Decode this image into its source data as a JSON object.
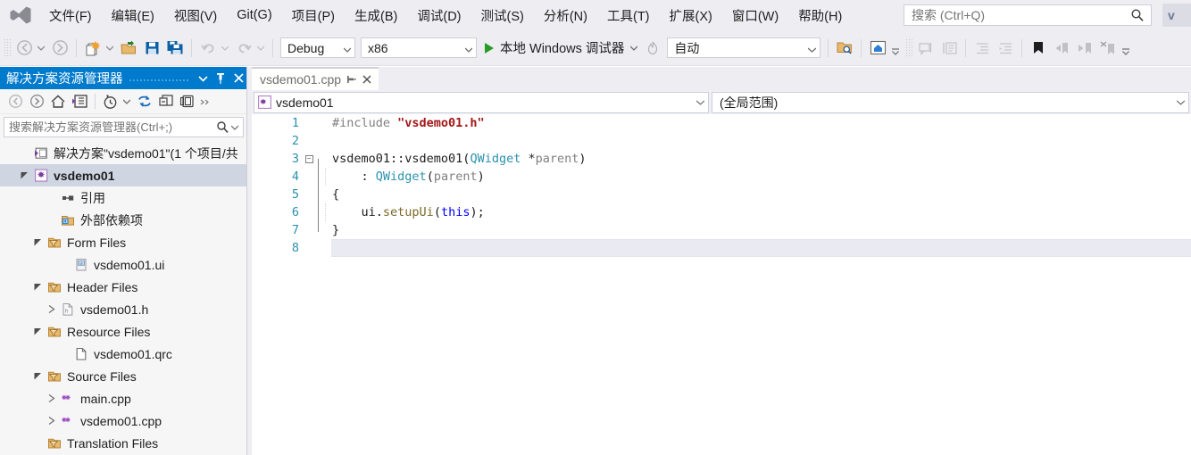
{
  "window": {
    "app": "Visual Studio",
    "title_fragment": "v",
    "logo_icon": "visual-studio-logo-icon"
  },
  "menubar": {
    "items": [
      {
        "label": "文件(F)",
        "name": "menu-file"
      },
      {
        "label": "编辑(E)",
        "name": "menu-edit"
      },
      {
        "label": "视图(V)",
        "name": "menu-view"
      },
      {
        "label": "Git(G)",
        "name": "menu-git"
      },
      {
        "label": "项目(P)",
        "name": "menu-project"
      },
      {
        "label": "生成(B)",
        "name": "menu-build"
      },
      {
        "label": "调试(D)",
        "name": "menu-debug"
      },
      {
        "label": "测试(S)",
        "name": "menu-test"
      },
      {
        "label": "分析(N)",
        "name": "menu-analyze"
      },
      {
        "label": "工具(T)",
        "name": "menu-tools"
      },
      {
        "label": "扩展(X)",
        "name": "menu-extensions"
      },
      {
        "label": "窗口(W)",
        "name": "menu-window"
      },
      {
        "label": "帮助(H)",
        "name": "menu-help"
      }
    ],
    "search": {
      "placeholder": "搜索 (Ctrl+Q)",
      "value": "",
      "icon": "search-icon"
    }
  },
  "toolbar": {
    "nav_back_icon": "navigate-back-icon",
    "nav_forward_icon": "navigate-forward-icon",
    "new_item_icon": "new-item-icon",
    "open_file_icon": "open-file-icon",
    "save_icon": "save-icon",
    "save_all_icon": "save-all-icon",
    "undo_icon": "undo-icon",
    "redo_icon": "redo-icon",
    "config": {
      "value": "Debug",
      "label": "Debug"
    },
    "platform": {
      "value": "x86",
      "label": "x86"
    },
    "run": {
      "label": "本地 Windows 调试器",
      "icon": "play-icon"
    },
    "hot_reload_icon": "hot-reload-icon",
    "auto_attach": {
      "value": "自动",
      "label": "自动"
    },
    "find_in_files_icon": "find-in-files-icon",
    "home_window_icon": "home-window-icon",
    "comment_icon": "comment-selection-icon",
    "uncomment_icon": "uncomment-selection-icon",
    "decrease_indent_icon": "decrease-indent-icon",
    "increase_indent_icon": "increase-indent-icon",
    "bookmark_icon": "bookmark-icon",
    "prev_bookmark_icon": "previous-bookmark-icon",
    "next_bookmark_icon": "next-bookmark-icon",
    "clear_bookmarks_icon": "clear-bookmarks-icon",
    "overflow_icon": "toolbar-overflow-icon"
  },
  "solution_explorer": {
    "header": {
      "title": "解决方案资源管理器",
      "dropdown_icon": "chevron-down-icon",
      "pin_icon": "pin-icon",
      "close_icon": "close-icon"
    },
    "toolbar": {
      "back_icon": "back-icon",
      "forward_icon": "forward-icon",
      "home_icon": "home-icon",
      "pending_changes_icon": "solution-view-icon",
      "show_all_files_icon": "history-clock-icon",
      "refresh_icon": "refresh-icon",
      "collapse_all_icon": "collapse-all-icon",
      "properties_icon": "properties-icon",
      "overflow_icon": "overflow-icon"
    },
    "search": {
      "placeholder": "搜索解决方案资源管理器(Ctrl+;)",
      "value": "",
      "icon": "search-icon",
      "dropdown_icon": "chevron-down-icon"
    },
    "tree": [
      {
        "label": "解决方案\"vsdemo01\"(1 个项目/共",
        "indent": 1,
        "twisty": "none",
        "icon": "solution-icon",
        "selected": false,
        "bold": false
      },
      {
        "label": "vsdemo01",
        "indent": 1,
        "twisty": "expanded",
        "icon": "cpp-project-icon",
        "selected": true,
        "bold": true
      },
      {
        "label": "引用",
        "indent": 3,
        "twisty": "none",
        "icon": "references-icon",
        "selected": false,
        "bold": false
      },
      {
        "label": "外部依赖项",
        "indent": 3,
        "twisty": "none",
        "icon": "external-dependencies-icon",
        "selected": false,
        "bold": false
      },
      {
        "label": "Form Files",
        "indent": 2,
        "twisty": "expanded",
        "icon": "filter-folder-icon",
        "selected": false,
        "bold": false
      },
      {
        "label": "vsdemo01.ui",
        "indent": 4,
        "twisty": "none",
        "icon": "ui-file-icon",
        "selected": false,
        "bold": false
      },
      {
        "label": "Header Files",
        "indent": 2,
        "twisty": "expanded",
        "icon": "filter-folder-icon",
        "selected": false,
        "bold": false
      },
      {
        "label": "vsdemo01.h",
        "indent": 3,
        "twisty": "collapsed",
        "icon": "header-file-icon",
        "selected": false,
        "bold": false
      },
      {
        "label": "Resource Files",
        "indent": 2,
        "twisty": "expanded",
        "icon": "filter-folder-icon",
        "selected": false,
        "bold": false
      },
      {
        "label": "vsdemo01.qrc",
        "indent": 4,
        "twisty": "none",
        "icon": "generic-file-icon",
        "selected": false,
        "bold": false
      },
      {
        "label": "Source Files",
        "indent": 2,
        "twisty": "expanded",
        "icon": "filter-folder-icon",
        "selected": false,
        "bold": false
      },
      {
        "label": "main.cpp",
        "indent": 3,
        "twisty": "collapsed",
        "icon": "cpp-file-icon",
        "selected": false,
        "bold": false
      },
      {
        "label": "vsdemo01.cpp",
        "indent": 3,
        "twisty": "collapsed",
        "icon": "cpp-file-icon",
        "selected": false,
        "bold": false
      },
      {
        "label": "Translation Files",
        "indent": 2,
        "twisty": "none",
        "icon": "filter-folder-icon",
        "selected": false,
        "bold": false
      }
    ]
  },
  "editor": {
    "tab": {
      "name": "vsdemo01.cpp",
      "pin_icon": "pin-icon",
      "close_icon": "close-icon"
    },
    "navbar": {
      "left": {
        "value": "vsdemo01",
        "icon": "cpp-project-icon",
        "dropdown_icon": "chevron-down-icon"
      },
      "right": {
        "value": "(全局范围)",
        "dropdown_icon": "chevron-down-icon"
      }
    },
    "current_line": 8,
    "code": [
      {
        "n": "1",
        "fold": "none",
        "guides": 0,
        "tokens": [
          {
            "t": "#include ",
            "c": "pre"
          },
          {
            "t": "\"vsdemo01.h\"",
            "c": "str"
          }
        ]
      },
      {
        "n": "2",
        "fold": "none",
        "guides": 0,
        "tokens": []
      },
      {
        "n": "3",
        "fold": "minus",
        "guides": 0,
        "tokens": [
          {
            "t": "vsdemo01::vsdemo01(",
            "c": "plain"
          },
          {
            "t": "QWidget",
            "c": "type"
          },
          {
            "t": " *",
            "c": "plain"
          },
          {
            "t": "parent",
            "c": "param"
          },
          {
            "t": ")",
            "c": "plain"
          }
        ]
      },
      {
        "n": "4",
        "fold": "none",
        "guides": 1,
        "tokens": [
          {
            "t": "    : ",
            "c": "plain"
          },
          {
            "t": "QWidget",
            "c": "type"
          },
          {
            "t": "(",
            "c": "plain"
          },
          {
            "t": "parent",
            "c": "param"
          },
          {
            "t": ")",
            "c": "plain"
          }
        ]
      },
      {
        "n": "5",
        "fold": "none",
        "guides": 0,
        "tokens": [
          {
            "t": "{",
            "c": "plain"
          }
        ]
      },
      {
        "n": "6",
        "fold": "none",
        "guides": 1,
        "tokens": [
          {
            "t": "    ui.",
            "c": "plain"
          },
          {
            "t": "setupUi",
            "c": "fn"
          },
          {
            "t": "(",
            "c": "plain"
          },
          {
            "t": "this",
            "c": "kw"
          },
          {
            "t": ");",
            "c": "plain"
          }
        ]
      },
      {
        "n": "7",
        "fold": "none",
        "guides": 0,
        "tokens": [
          {
            "t": "}",
            "c": "plain"
          }
        ]
      },
      {
        "n": "8",
        "fold": "none",
        "guides": 0,
        "tokens": []
      }
    ]
  },
  "colors": {
    "accent": "#007acc",
    "chrome": "#eeeef2",
    "panel": "#f6f6f6",
    "selection": "#cfd6e2",
    "current_line": "#eaeaf2",
    "string": "#a31515",
    "type": "#2b91af",
    "keyword": "#0000ff",
    "function": "#7a6a28",
    "preprocessor": "#808080",
    "run_green": "#269c26"
  }
}
